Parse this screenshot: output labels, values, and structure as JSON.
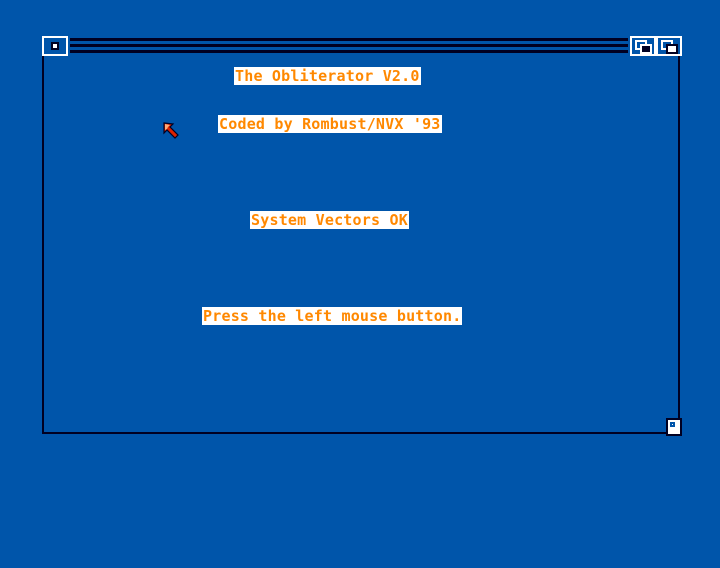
{
  "window": {
    "lines": [
      "The Obliterator V2.0",
      "Coded by Rombust/NVX '93",
      "System Vectors OK",
      "Press the left mouse button."
    ]
  },
  "colors": {
    "screen_background": "#0055aa",
    "text": "#ff8800",
    "text_background": "#ffffff",
    "frame": "#000022"
  },
  "icons": {
    "pointer": "mouse-pointer-icon",
    "close": "close-gadget-icon",
    "depth": "depth-gadget-icon",
    "resize": "resize-gadget-icon"
  }
}
